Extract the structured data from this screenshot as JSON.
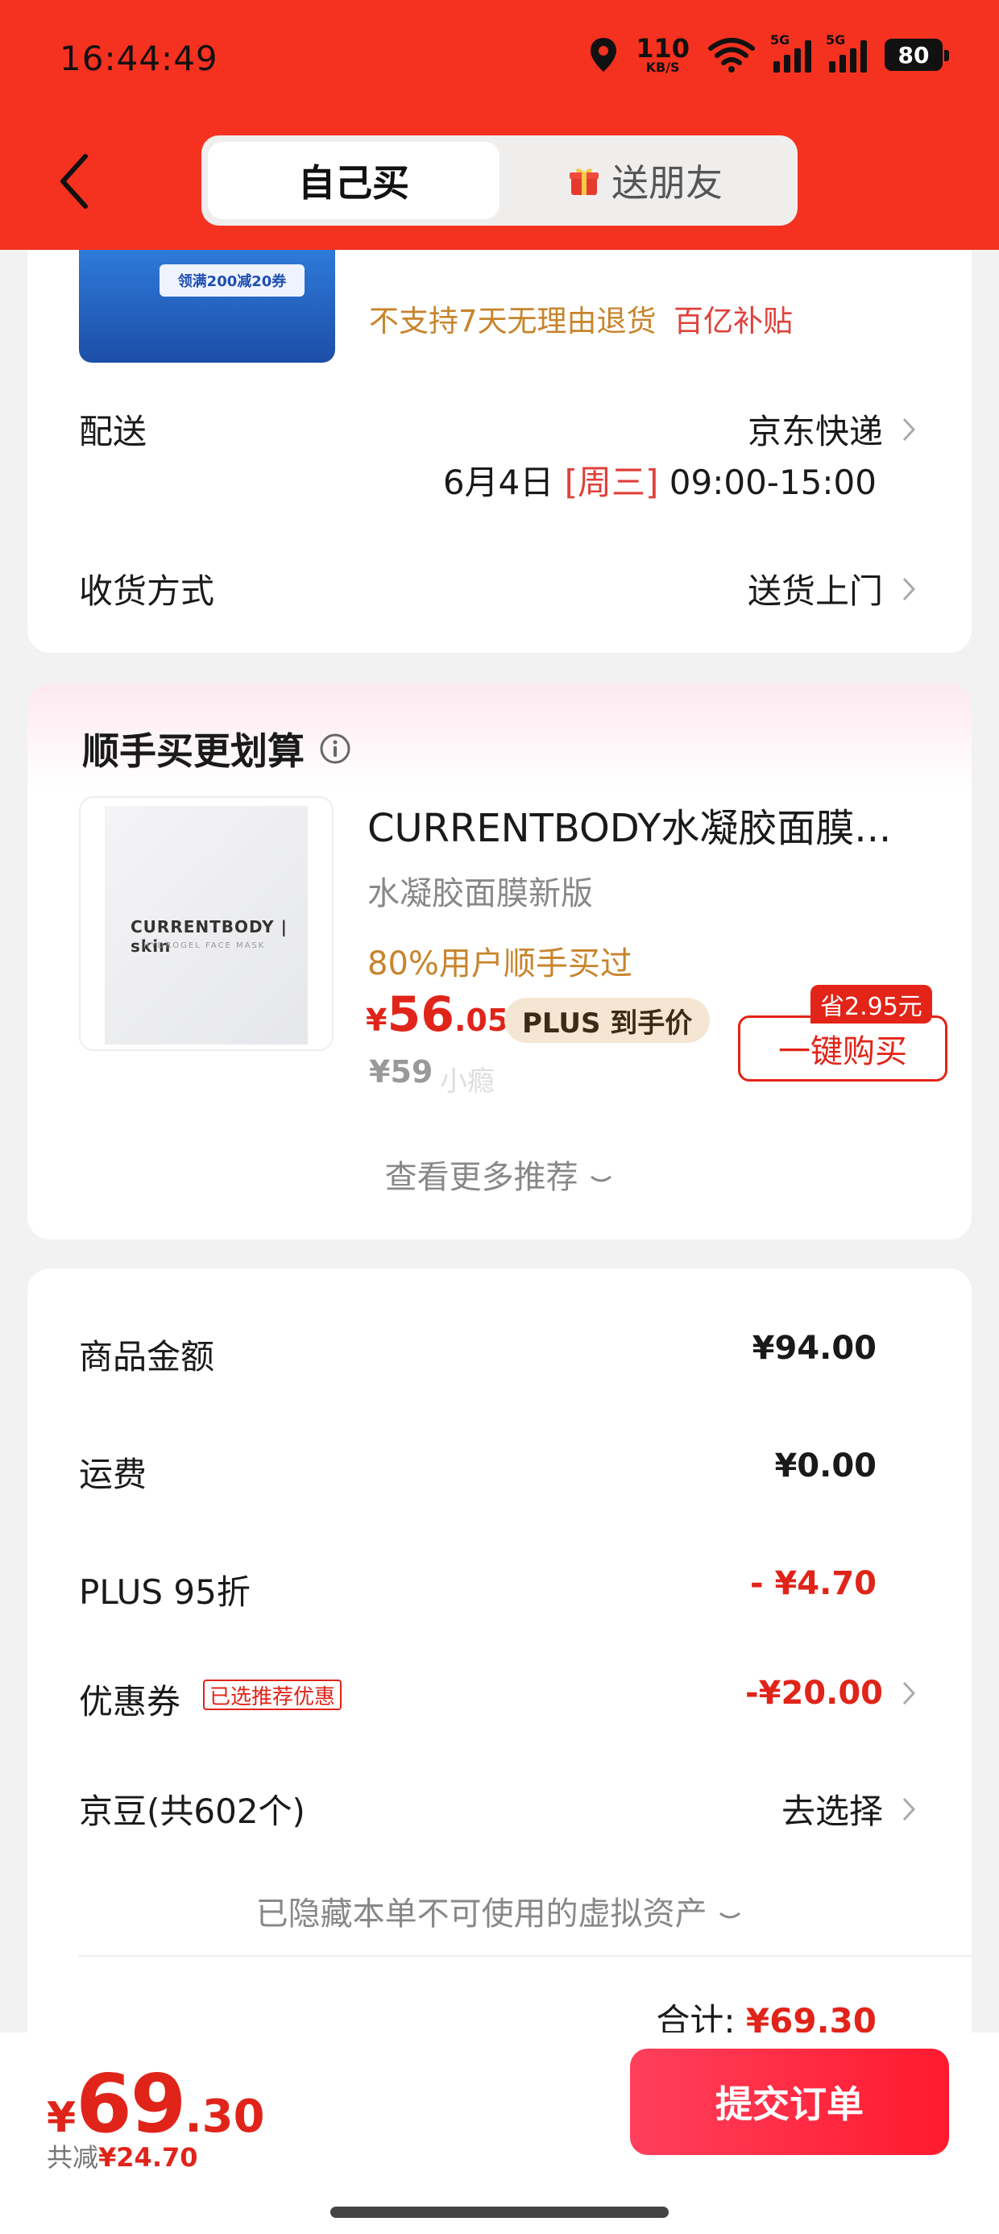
{
  "status_bar": {
    "time": "16:44:49",
    "net_speed_value": "110",
    "net_speed_unit": "KB/S",
    "sig1_label": "5G",
    "sig2_label": "5G",
    "battery": "80"
  },
  "header": {
    "tabs": [
      {
        "label": "自己买",
        "active": true
      },
      {
        "label": "送朋友",
        "active": false
      }
    ]
  },
  "product_top": {
    "banner_text": "领满200减20券",
    "no_return": "不支持7天无理由退货",
    "subsidy": "百亿补贴"
  },
  "delivery": {
    "label": "配送",
    "carrier": "京东快递",
    "date": "6月4日",
    "weekday": "[周三]",
    "time_range": "09:00-15:00"
  },
  "receive": {
    "label": "收货方式",
    "value": "送货上门"
  },
  "bundle": {
    "title": "顺手买更划算",
    "product_name": "CURRENTBODY水凝胶面膜...",
    "spec": "水凝胶面膜新版",
    "hint": "80%用户顺手买过",
    "price_symbol": "¥",
    "price_int": "56",
    "price_dec": ".05",
    "plus_tag": "PLUS 到手价",
    "orig_price": "¥59",
    "orig_note": "小瘾",
    "save_badge": "省2.95元",
    "buy_button": "一键购买",
    "more": "查看更多推荐",
    "img_brand": "CURRENTBODY | skin",
    "img_sub": "HYDROGEL FACE MASK"
  },
  "fees": {
    "goods_label": "商品金额",
    "goods_value": "¥94.00",
    "ship_label": "运费",
    "ship_value": "¥0.00",
    "plus_label": "PLUS 95折",
    "plus_value": "- ¥4.70",
    "coupon_label": "优惠券",
    "coupon_tag": "已选推荐优惠",
    "coupon_value": "-¥20.00",
    "beans_label": "京豆(共602个)",
    "beans_value": "去选择",
    "hidden_assets": "已隐藏本单不可使用的虚拟资产",
    "subtotal_label": "合计:",
    "subtotal_value": "¥69.30"
  },
  "bottom": {
    "price_symbol": "¥",
    "price_int": "69",
    "price_dec": ".30",
    "saved_label": "共减",
    "saved_value": "¥24.70",
    "submit": "提交订单"
  },
  "colors": {
    "brand_red": "#f5311f",
    "price_red": "#e0241a",
    "hint_gold": "#c8842c"
  }
}
